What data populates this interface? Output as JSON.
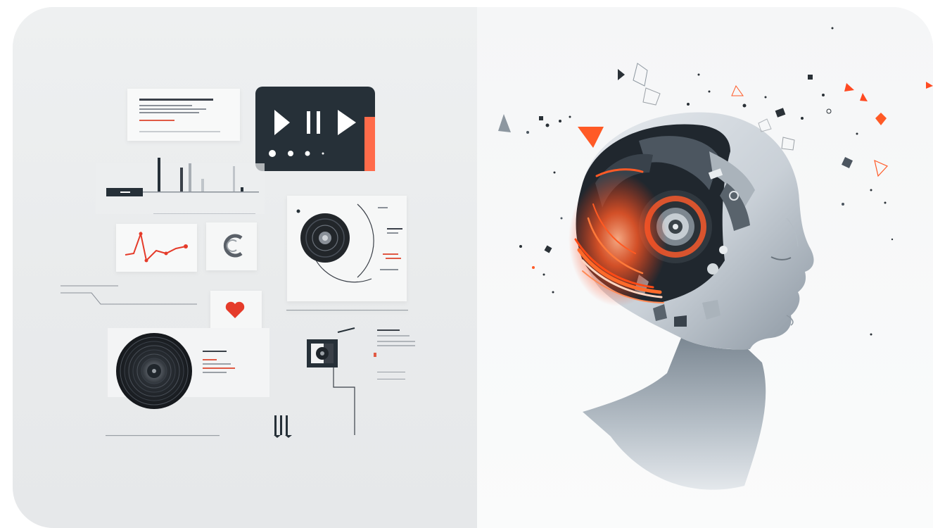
{
  "colors": {
    "accent": "#ff6b4a",
    "dark": "#263038",
    "panel": "#f7f8f8",
    "red": "#e53b2a",
    "skin": "#dde2e7"
  },
  "left_panel": {
    "icons": [
      "play-icon",
      "pause-icon",
      "play-icon",
      "heart-icon",
      "ring-icon",
      "speaker-icon",
      "vinyl-disc-icon"
    ]
  },
  "right_panel": {
    "icons": [
      "robot-head-icon",
      "speaker-icon"
    ]
  }
}
